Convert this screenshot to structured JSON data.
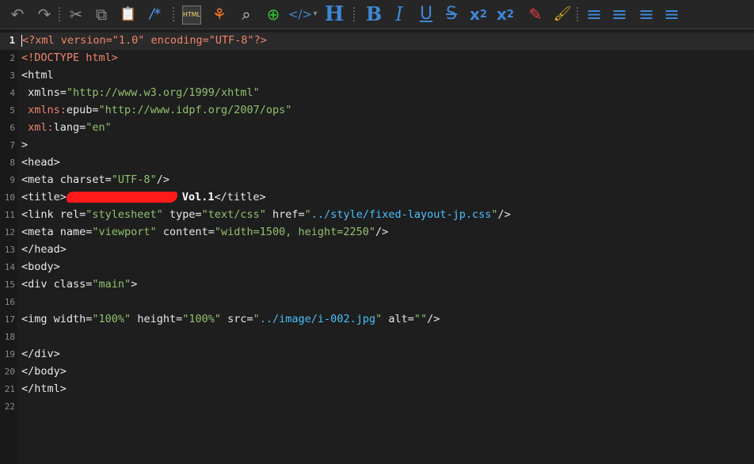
{
  "toolbar": {
    "undo": "↶",
    "redo": "↷",
    "cut": "✂",
    "copy": "⧉",
    "paste": "📋",
    "comment": "/*",
    "html": "HTML",
    "tulip": "⚘",
    "find": "⌕",
    "plus": "⊕",
    "code": "</>",
    "code_caret": "▾",
    "heading": "H",
    "bold": "B",
    "italic": "I",
    "underline": "U",
    "strike": "S",
    "subscript_base": "x",
    "subscript_sub": "2",
    "superscript_base": "x",
    "superscript_sup": "2",
    "marker": "✎",
    "brush": "🖌",
    "align_left": "≡",
    "align_center": "≡",
    "align_right": "≡",
    "justify": "≡"
  },
  "editor": {
    "lines": [
      {
        "n": "1",
        "active": true,
        "seg": [
          {
            "c": "pi",
            "t": "<?xml version=\"1.0\" encoding=\"UTF-8\"?>"
          }
        ]
      },
      {
        "n": "2",
        "seg": [
          {
            "c": "pi",
            "t": "<!DOCTYPE html>"
          }
        ]
      },
      {
        "n": "3",
        "seg": [
          {
            "c": "p",
            "t": "<html"
          }
        ]
      },
      {
        "n": "4",
        "seg": [
          {
            "c": "a",
            "t": " xmlns="
          },
          {
            "c": "s",
            "t": "\"http://www.w3.org/1999/xhtml\""
          }
        ]
      },
      {
        "n": "5",
        "seg": [
          {
            "c": "nsp",
            "t": " xmlns:"
          },
          {
            "c": "a",
            "t": "epub="
          },
          {
            "c": "s",
            "t": "\"http://www.idpf.org/2007/ops\""
          }
        ]
      },
      {
        "n": "6",
        "seg": [
          {
            "c": "nsp",
            "t": " xml:"
          },
          {
            "c": "a",
            "t": "lang="
          },
          {
            "c": "s",
            "t": "\"en\""
          }
        ]
      },
      {
        "n": "7",
        "seg": [
          {
            "c": "p",
            "t": ">"
          }
        ]
      },
      {
        "n": "8",
        "seg": [
          {
            "c": "p",
            "t": "<head>"
          }
        ]
      },
      {
        "n": "9",
        "seg": [
          {
            "c": "p",
            "t": "<meta charset="
          },
          {
            "c": "s",
            "t": "\"UTF-8\""
          },
          {
            "c": "p",
            "t": "/>"
          }
        ]
      },
      {
        "n": "10",
        "seg": [
          {
            "c": "p",
            "t": "<title>"
          },
          {
            "c": "redact",
            "t": ""
          },
          {
            "c": "wh",
            "t": "Vol.1"
          },
          {
            "c": "p",
            "t": "</title>"
          }
        ]
      },
      {
        "n": "11",
        "seg": [
          {
            "c": "p",
            "t": "<link rel="
          },
          {
            "c": "s",
            "t": "\"stylesheet\""
          },
          {
            "c": "p",
            "t": " type="
          },
          {
            "c": "s",
            "t": "\"text/css\""
          },
          {
            "c": "p",
            "t": " href="
          },
          {
            "c": "s",
            "t": "\""
          },
          {
            "c": "u",
            "t": "../style/fixed-layout-jp.css"
          },
          {
            "c": "s",
            "t": "\""
          },
          {
            "c": "p",
            "t": "/>"
          }
        ]
      },
      {
        "n": "12",
        "seg": [
          {
            "c": "p",
            "t": "<meta name="
          },
          {
            "c": "s",
            "t": "\"viewport\""
          },
          {
            "c": "p",
            "t": " content="
          },
          {
            "c": "s",
            "t": "\"width=1500, height=2250\""
          },
          {
            "c": "p",
            "t": "/>"
          }
        ]
      },
      {
        "n": "13",
        "seg": [
          {
            "c": "p",
            "t": "</head>"
          }
        ]
      },
      {
        "n": "14",
        "seg": [
          {
            "c": "p",
            "t": "<body>"
          }
        ]
      },
      {
        "n": "15",
        "seg": [
          {
            "c": "p",
            "t": "<div class="
          },
          {
            "c": "s",
            "t": "\"main\""
          },
          {
            "c": "p",
            "t": ">"
          }
        ]
      },
      {
        "n": "16",
        "seg": []
      },
      {
        "n": "17",
        "seg": [
          {
            "c": "p",
            "t": "<img width="
          },
          {
            "c": "s",
            "t": "\"100%\""
          },
          {
            "c": "p",
            "t": " height="
          },
          {
            "c": "s",
            "t": "\"100%\""
          },
          {
            "c": "p",
            "t": " src="
          },
          {
            "c": "s",
            "t": "\""
          },
          {
            "c": "u",
            "t": "../image/i-002.jpg"
          },
          {
            "c": "s",
            "t": "\""
          },
          {
            "c": "p",
            "t": " alt="
          },
          {
            "c": "s",
            "t": "\"\""
          },
          {
            "c": "p",
            "t": "/>"
          }
        ]
      },
      {
        "n": "18",
        "seg": []
      },
      {
        "n": "19",
        "seg": [
          {
            "c": "p",
            "t": "</div>"
          }
        ]
      },
      {
        "n": "20",
        "seg": [
          {
            "c": "p",
            "t": "</body>"
          }
        ]
      },
      {
        "n": "21",
        "seg": [
          {
            "c": "p",
            "t": "</html>"
          }
        ]
      },
      {
        "n": "22",
        "seg": []
      }
    ]
  }
}
